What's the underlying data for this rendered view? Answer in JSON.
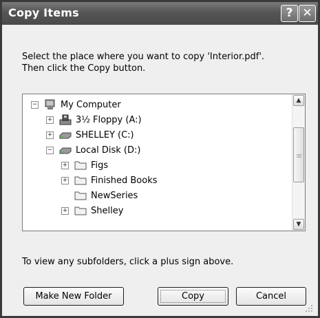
{
  "window": {
    "title": "Copy Items",
    "help_glyph": "?",
    "close_glyph": "✕"
  },
  "instructions": {
    "line1": "Select the place where you want to copy 'Interior.pdf'.",
    "line2": "Then click the Copy button."
  },
  "tree": {
    "items": [
      {
        "label": "My Computer",
        "expander": "−",
        "icon": "computer-icon"
      },
      {
        "label": "3½ Floppy (A:)",
        "expander": "+",
        "icon": "floppy-drive-icon"
      },
      {
        "label": "SHELLEY (C:)",
        "expander": "+",
        "icon": "hard-drive-icon"
      },
      {
        "label": "Local Disk (D:)",
        "expander": "−",
        "icon": "hard-drive-icon"
      },
      {
        "label": "Figs",
        "expander": "+",
        "icon": "folder-icon"
      },
      {
        "label": "Finished Books",
        "expander": "+",
        "icon": "folder-icon"
      },
      {
        "label": "NewSeries",
        "expander": "",
        "icon": "folder-icon"
      },
      {
        "label": "Shelley",
        "expander": "+",
        "icon": "folder-icon"
      }
    ],
    "scroll_up_glyph": "▲",
    "scroll_down_glyph": "▼"
  },
  "hint": "To view any subfolders, click a plus sign above.",
  "buttons": {
    "make_new_folder": "Make New Folder",
    "copy": "Copy",
    "cancel": "Cancel"
  }
}
